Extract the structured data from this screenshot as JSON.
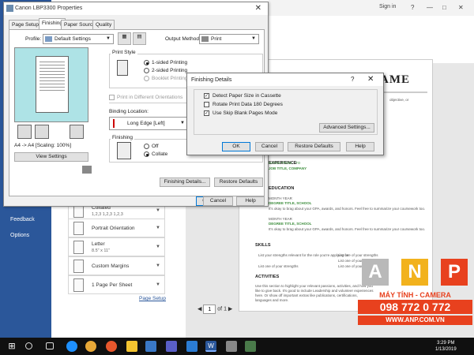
{
  "backstage": {
    "nav": [
      "Feedback",
      "Options"
    ],
    "signin": "Sign in",
    "win_controls": [
      "?",
      "—",
      "□",
      "✕"
    ],
    "settings": [
      {
        "title": "Collated",
        "sub": "1,2,3    1,2,3    1,2,3"
      },
      {
        "title": "Portrait Orientation",
        "sub": ""
      },
      {
        "title": "Letter",
        "sub": "8.5\" x 11\""
      },
      {
        "title": "Custom Margins",
        "sub": ""
      },
      {
        "title": "1 Page Per Sheet",
        "sub": ""
      }
    ],
    "page_setup_link": "Page Setup",
    "page_nav": {
      "current": "1",
      "of": "of 1"
    }
  },
  "document": {
    "title_fragment": "AME",
    "sections": [
      "EXPERIENCE",
      "EDUCATION",
      "SKILLS",
      "ACTIVITIES"
    ],
    "company_line": "JOB TITLE, COMPANY",
    "dates_line": "DATES FROM – TO",
    "edu_entries": [
      {
        "year": "MONTH YEAR",
        "degree": "DEGREE TITLE, SCHOOL"
      },
      {
        "year": "MONTH YEAR",
        "degree": "DEGREE TITLE, SCHOOL"
      }
    ],
    "body_text": "It's okay to brag about your GPA, awards, and honors. Feel free to summarize your coursework too.",
    "skills": [
      "List your strengths relevant for the role you're applying for",
      "List one of your strengths",
      "List one of your strengths",
      "List one of your strengths",
      "List one of your strengths"
    ],
    "activities_text": "Use this section to highlight your relevant passions, activities, and how you like to give back. It's good to include Leadership and volunteer experiences here. Or show off important extras like publications, certifications, languages and more."
  },
  "watermark": {
    "letters": [
      "A",
      "N",
      "P"
    ],
    "sub": "MÁY TÍNH - CAMERA",
    "phone": "098 772 0 772",
    "url": "WWW.ANP.COM.VN",
    "colors": {
      "red": "#e8411e",
      "grey": "#b9b9b9",
      "yellow": "#f2b21d"
    }
  },
  "properties": {
    "title": "Canon LBP3300 Properties",
    "tabs": [
      "Page Setup",
      "Finishing",
      "Paper Source",
      "Quality"
    ],
    "active_tab": "Finishing",
    "profile_label": "Profile:",
    "profile_value": "Default Settings",
    "output_label": "Output Method:",
    "output_value": "Print",
    "preview_caption": "A4 -> A4 [Scaling: 100%]",
    "view_settings": "View Settings",
    "print_style": {
      "title": "Print Style",
      "options": [
        "1-sided Printing",
        "2-sided Printing",
        "Booklet Printing"
      ],
      "selected": "1-sided Printing",
      "orientation_check": "Print in Different Orientations"
    },
    "binding": {
      "label": "Binding Location:",
      "value": "Long Edge [Left]"
    },
    "finishing": {
      "title": "Finishing",
      "options": [
        "Off",
        "Collate"
      ],
      "selected": "Collate"
    },
    "buttons": {
      "finishing_details": "Finishing Details...",
      "restore": "Restore Defaults",
      "ok": "OK",
      "cancel": "Cancel",
      "help": "Help"
    }
  },
  "finishing_details": {
    "title": "Finishing Details",
    "help_glyph": "?",
    "close_glyph": "✕",
    "checks": [
      {
        "label": "Detect Paper Size in Cassette",
        "checked": true
      },
      {
        "label": "Rotate Print Data 180 Degrees",
        "checked": false
      },
      {
        "label": "Use Skip Blank Pages Mode",
        "checked": true
      }
    ],
    "advanced": "Advanced Settings...",
    "buttons": {
      "ok": "OK",
      "cancel": "Cancel",
      "restore": "Restore Defaults",
      "help": "Help"
    }
  },
  "taskbar": {
    "time": "3:29 PM",
    "date": "1/13/2019",
    "icons": [
      "windows-start",
      "search",
      "task-view",
      "edge",
      "chrome",
      "firefox",
      "explorer",
      "store",
      "teams",
      "mail",
      "word",
      "settings",
      "app"
    ]
  }
}
